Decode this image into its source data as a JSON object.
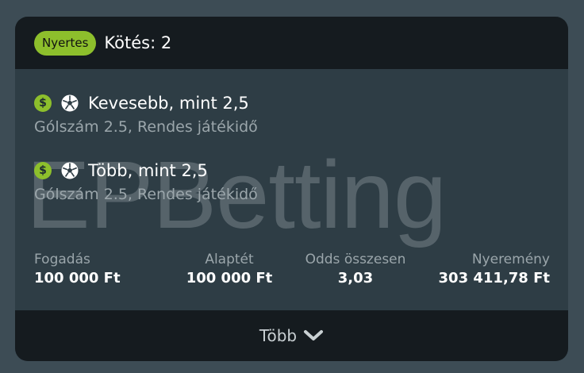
{
  "card": {
    "badge": "Nyertes",
    "title": "Kötés: 2",
    "watermark": "EPBetting",
    "selections": [
      {
        "title": "Kevesebb, mint 2,5",
        "subtitle": "Gólszám 2.5, Rendes játékidő"
      },
      {
        "title": "Több, mint 2,5",
        "subtitle": "Gólszám 2.5, Rendes játékidő"
      }
    ],
    "summary": {
      "stake_label": "Fogadás",
      "stake_value": "100 000 Ft",
      "base_label": "Alaptét",
      "base_value": "100 000 Ft",
      "odds_label": "Odds összesen",
      "odds_value": "3,03",
      "win_label": "Nyeremény",
      "win_value": "303 411,78 Ft"
    },
    "more_label": "Több"
  },
  "colors": {
    "accent": "#8dbf2c",
    "page_bg": "#3d4c55",
    "card_bg": "#2e3d45",
    "header_bg": "#151b1f"
  },
  "icons": [
    "dollar-icon",
    "soccer-ball-icon",
    "chevron-down-icon"
  ]
}
